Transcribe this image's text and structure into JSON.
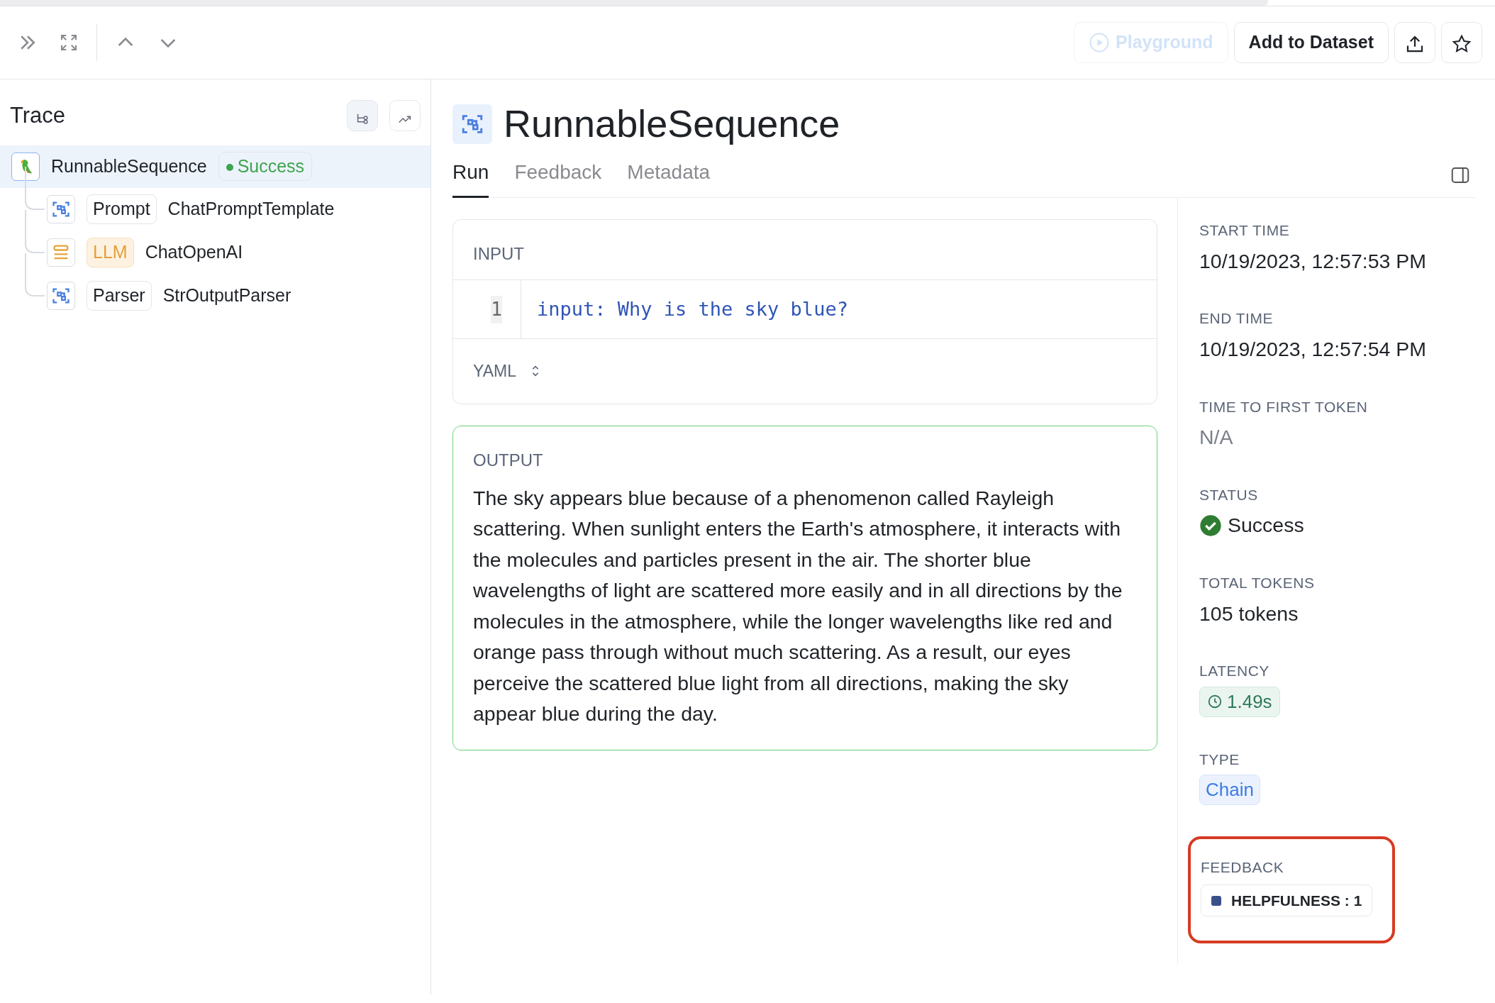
{
  "toolbar": {
    "buttons": [
      {
        "kind": "playground",
        "label": "Playground",
        "disabled": true
      },
      {
        "kind": "text",
        "label": "Add to Dataset",
        "disabled": false
      },
      {
        "kind": "share"
      },
      {
        "kind": "star"
      }
    ]
  },
  "trace": {
    "title": "Trace",
    "nodes": [
      {
        "kind": "sequence",
        "name": "RunnableSequence",
        "status": "Success",
        "selected": true,
        "children": [
          {
            "kind": "prompt",
            "tag": "Prompt",
            "name": "ChatPromptTemplate",
            "selected": false
          },
          {
            "kind": "llm",
            "tag": "LLM",
            "name": "ChatOpenAI",
            "selected": false
          },
          {
            "kind": "parser",
            "tag": "Parser",
            "name": "StrOutputParser",
            "selected": false
          }
        ]
      }
    ]
  },
  "run": {
    "title": "RunnableSequence",
    "tabs": [
      {
        "label": "Run",
        "selected": true
      },
      {
        "label": "Feedback",
        "selected": false
      },
      {
        "label": "Metadata",
        "selected": false
      }
    ],
    "input": {
      "title": "INPUT",
      "lines": [
        {
          "number": "1",
          "code": "input: Why is the sky blue?"
        }
      ],
      "format": "YAML"
    },
    "output": {
      "title": "OUTPUT",
      "text": "The sky appears blue because of a phenomenon called Rayleigh scattering. When sunlight enters the Earth's atmosphere, it interacts with the molecules and particles present in the air. The shorter blue wavelengths of light are scattered more easily and in all directions by the molecules in the atmosphere, while the longer wavelengths like red and orange pass through without much scattering. As a result, our eyes perceive the scattered blue light from all directions, making the sky appear blue during the day."
    },
    "details": [
      {
        "kind": "text",
        "label": "START TIME",
        "value": "10/19/2023, 12:57:53 PM"
      },
      {
        "kind": "text",
        "label": "END TIME",
        "value": "10/19/2023, 12:57:54 PM"
      },
      {
        "kind": "muted",
        "label": "TIME TO FIRST TOKEN",
        "value": "N/A"
      },
      {
        "kind": "status",
        "label": "STATUS",
        "value": "Success"
      },
      {
        "kind": "text",
        "label": "TOTAL TOKENS",
        "value": "105 tokens"
      },
      {
        "kind": "latency",
        "label": "LATENCY",
        "value": "1.49s"
      },
      {
        "kind": "type",
        "label": "TYPE",
        "value": "Chain"
      },
      {
        "kind": "feedback",
        "label": "FEEDBACK",
        "value": "HELPFULNESS : 1",
        "color": "#3b4f8a",
        "highlighted": true
      }
    ]
  }
}
